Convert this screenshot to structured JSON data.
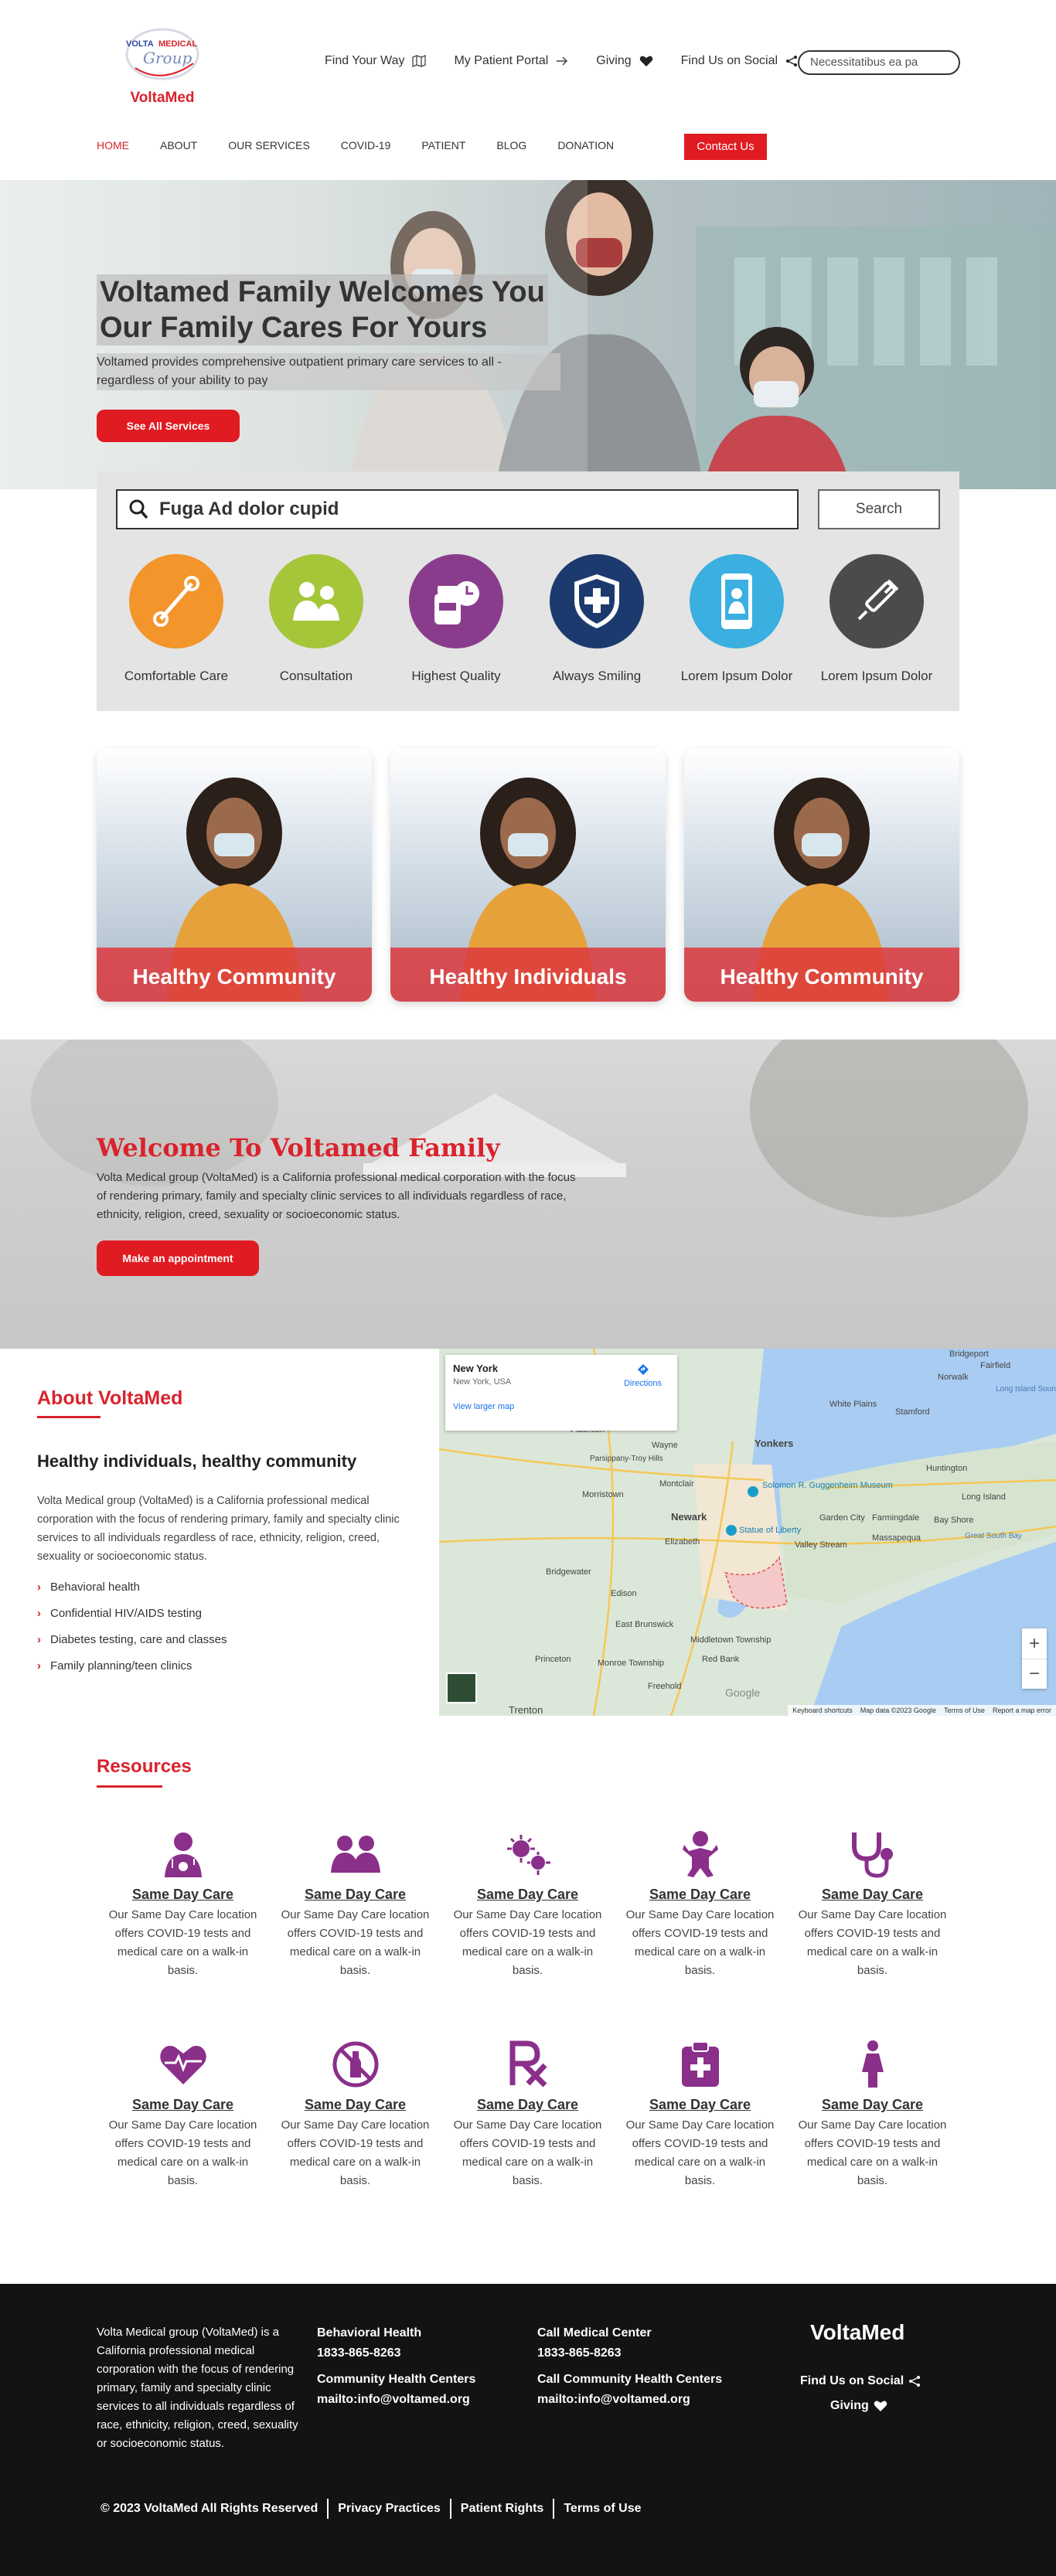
{
  "brand": {
    "logo_text": "VOLTA MEDICAL",
    "logo_sub": "Group",
    "name": "VoltaMed"
  },
  "top_nav": [
    {
      "label": "Find Your Way",
      "icon": "map-icon"
    },
    {
      "label": "My Patient Portal",
      "icon": "arrow-right-icon"
    },
    {
      "label": "Giving",
      "icon": "heart-icon"
    },
    {
      "label": "Find Us on Social",
      "icon": "share-icon"
    }
  ],
  "top_search": {
    "value": "Necessitatibus ea pa"
  },
  "main_nav": [
    "HOME",
    "ABOUT",
    "OUR SERVICES",
    "COVID-19",
    "PATIENT",
    "BLOG",
    "DONATION"
  ],
  "contact_button": "Contact Us",
  "hero": {
    "title_line1": "Voltamed Family Welcomes You",
    "title_line2": "Our Family Cares For Yours",
    "subtitle": "Voltamed provides comprehensive outpatient primary care services to all - regardless of your ability to pay",
    "button": "See All Services"
  },
  "services": {
    "search_value": "Fuga Ad dolor cupid",
    "search_button": "Search",
    "items": [
      {
        "label": "Comfortable Care",
        "color": "#f3952b",
        "icon": "bandage-icon"
      },
      {
        "label": "Consultation",
        "color": "#a6c63a",
        "icon": "consultation-icon"
      },
      {
        "label": "Highest Quality",
        "color": "#8a3c8c",
        "icon": "pills-clock-icon"
      },
      {
        "label": "Always Smiling",
        "color": "#1c3a6e",
        "icon": "shield-cross-icon"
      },
      {
        "label": "Lorem Ipsum Dolor",
        "color": "#3aafe0",
        "icon": "mobile-doctor-icon"
      },
      {
        "label": "Lorem Ipsum Dolor",
        "color": "#4b4b4b",
        "icon": "syringe-icon"
      }
    ]
  },
  "cards": [
    "Healthy Community",
    "Healthy Individuals",
    "Healthy Community"
  ],
  "welcome": {
    "title": "Welcome To Voltamed Family",
    "text": "Volta Medical group (VoltaMed) is a California professional medical corporation with the focus of rendering primary, family and specialty clinic services to all individuals regardless of race, ethnicity, religion, creed, sexuality or socioeconomic status.",
    "button": "Make an appointment"
  },
  "about": {
    "title": "About VoltaMed",
    "subtitle": "Healthy individuals, healthy community",
    "text": "Volta Medical group (VoltaMed) is a California professional medical corporation with the focus of rendering primary, family and specialty clinic services to all individuals regardless of race, ethnicity, religion, creed, sexuality or socioeconomic status.",
    "list": [
      "Behavioral health",
      "Confidential HIV/AIDS testing",
      "Diabetes testing, care and classes",
      "Family planning/teen clinics"
    ]
  },
  "map": {
    "place": "New York",
    "place_sub": "New York, USA",
    "directions": "Directions",
    "larger_map": "View larger map",
    "labels": [
      "Bridgeport",
      "Fairfield",
      "Norwalk",
      "Stamford",
      "White Plains",
      "Yonkers",
      "Paterson",
      "Wayne",
      "Montclair",
      "Morristown",
      "Newark",
      "Elizabeth",
      "Garden City",
      "Farmingdale",
      "Huntington",
      "Long Island",
      "Bay Shore",
      "Great South Bay",
      "Massapequa",
      "Valley Stream",
      "Bridgewater",
      "Edison",
      "East Brunswick",
      "Princeton",
      "Middletown Township",
      "Red Bank",
      "Freehold",
      "Trenton",
      "Monroe Township",
      "Statue of Liberty",
      "Solomon R. Guggenheim Museum",
      "Parsippany-Troy Hills",
      "Long Island Sound"
    ],
    "footer": [
      "Keyboard shortcuts",
      "Map data ©2023 Google",
      "Terms of Use",
      "Report a map error"
    ],
    "zoom_in": "+",
    "zoom_out": "−",
    "google": "Google"
  },
  "resources": {
    "title": "Resources",
    "items": [
      {
        "icon": "doctor-icon",
        "title": "Same Day Care",
        "text": "Our Same Day Care location offers COVID-19 tests and medical care on a walk-in basis."
      },
      {
        "icon": "family-icon",
        "title": "Same Day Care",
        "text": "Our Same Day Care location offers COVID-19 tests and medical care on a walk-in basis."
      },
      {
        "icon": "virus-icon",
        "title": "Same Day Care",
        "text": "Our Same Day Care location offers COVID-19 tests and medical care on a walk-in basis."
      },
      {
        "icon": "baby-icon",
        "title": "Same Day Care",
        "text": "Our Same Day Care location offers COVID-19 tests and medical care on a walk-in basis."
      },
      {
        "icon": "stethoscope-icon",
        "title": "Same Day Care",
        "text": "Our Same Day Care location offers COVID-19 tests and medical care on a walk-in basis."
      },
      {
        "icon": "heartbeat-icon",
        "title": "Same Day Care",
        "text": "Our Same Day Care location offers COVID-19 tests and medical care on a walk-in basis."
      },
      {
        "icon": "no-alcohol-icon",
        "title": "Same Day Care",
        "text": "Our Same Day Care location offers COVID-19 tests and medical care on a walk-in basis."
      },
      {
        "icon": "prescription-icon",
        "title": "Same Day Care",
        "text": "Our Same Day Care location offers COVID-19 tests and medical care on a walk-in basis."
      },
      {
        "icon": "medical-bag-icon",
        "title": "Same Day Care",
        "text": "Our Same Day Care location offers COVID-19 tests and medical care on a walk-in basis."
      },
      {
        "icon": "female-icon",
        "title": "Same Day Care",
        "text": "Our Same Day Care location offers COVID-19 tests and medical care on a walk-in basis."
      }
    ]
  },
  "footer": {
    "about": "Volta Medical group (VoltaMed) is a California professional medical corporation with the focus of rendering primary, family and specialty clinic services to all individuals regardless of race, ethnicity, religion, creed, sexuality or socioeconomic status.",
    "col1": {
      "h1": "Behavioral Health",
      "p1": "1833-865-8263",
      "h2": "Community Health Centers",
      "p2": "mailto:info@voltamed.org"
    },
    "col2": {
      "h1": "Call Medical Center",
      "p1": "1833-865-8263",
      "h2": "Call Community Health Centers",
      "p2": "mailto:info@voltamed.org"
    },
    "brand": "VoltaMed",
    "social": "Find Us on Social",
    "giving": "Giving",
    "links": [
      "© 2023 VoltaMed All Rights Reserved",
      "Privacy Practices",
      "Patient Rights",
      "Terms of Use"
    ]
  },
  "colors": {
    "accent": "#e01b22",
    "brand_red": "#d9232d",
    "resource_purple": "#8a2f8a",
    "footer_bg": "#131313"
  }
}
